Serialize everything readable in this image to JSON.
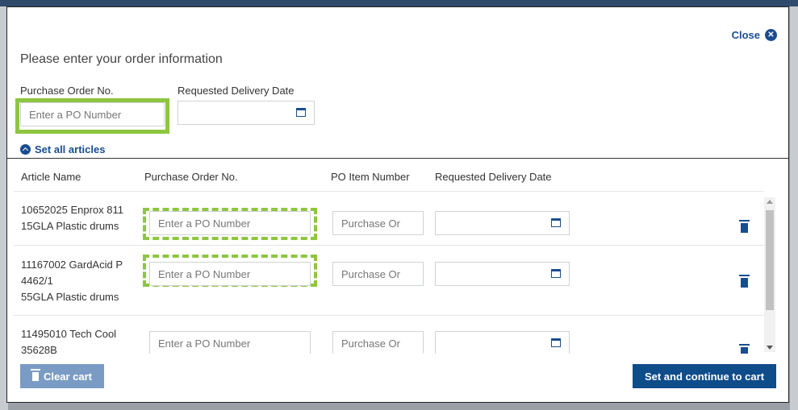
{
  "modal": {
    "close_label": "Close",
    "title": "Please enter your order information"
  },
  "order": {
    "po_label": "Purchase Order No.",
    "po_placeholder": "Enter a PO Number",
    "date_label": "Requested Delivery Date",
    "set_all_label": "Set all articles"
  },
  "table": {
    "headers": [
      "Article Name",
      "Purchase Order No.",
      "PO Item Number",
      "Requested Delivery Date"
    ],
    "po_placeholder": "Enter a PO Number",
    "item_placeholder": "Purchase Or",
    "rows": [
      {
        "line1": "10652025 Enprox 811",
        "line2": "15GLA Plastic drums",
        "line3": ""
      },
      {
        "line1": "11167002 GardAcid P",
        "line2": "4462/1",
        "line3": "55GLA Plastic drums"
      },
      {
        "line1": "11495010 Tech Cool",
        "line2": "35628B",
        "line3": ""
      }
    ]
  },
  "footer": {
    "clear_label": "Clear cart",
    "set_label": "Set and continue to cart"
  },
  "colors": {
    "brand_blue": "#1a4d8f",
    "highlight_green": "#8dc63f"
  }
}
